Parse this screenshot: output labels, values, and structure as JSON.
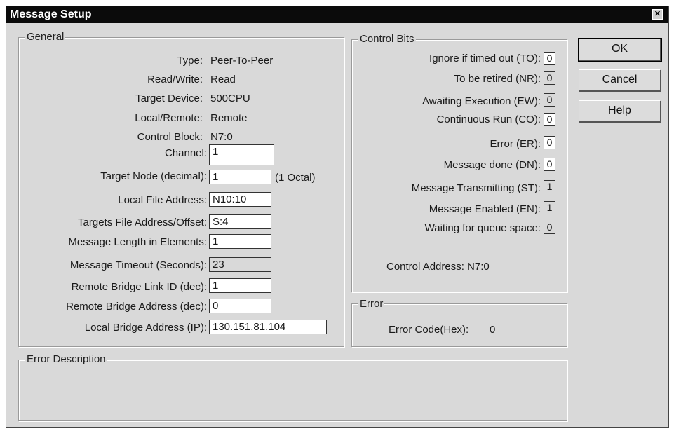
{
  "window": {
    "title": "Message Setup"
  },
  "general": {
    "legend": "General",
    "info": [
      {
        "label": "Type:",
        "value": "Peer-To-Peer"
      },
      {
        "label": "Read/Write:",
        "value": "Read"
      },
      {
        "label": "Target Device:",
        "value": "500CPU"
      },
      {
        "label": "Local/Remote:",
        "value": "Remote"
      },
      {
        "label": "Control Block:",
        "value": "N7:0"
      }
    ],
    "fields": [
      {
        "label": "Channel:",
        "value": "1"
      },
      {
        "label": "Target Node (decimal):",
        "value": "1",
        "suffix": "(1 Octal)"
      },
      {
        "label": "Local File Address:",
        "value": "N10:10"
      },
      {
        "label": "Targets File Address/Offset:",
        "value": "S:4"
      },
      {
        "label": "Message Length in Elements:",
        "value": "1"
      },
      {
        "label": "Message Timeout (Seconds):",
        "value": "23"
      },
      {
        "label": "Remote Bridge Link ID (dec):",
        "value": "1"
      },
      {
        "label": "Remote Bridge Address (dec):",
        "value": "0"
      },
      {
        "label": "Local Bridge Address (IP):",
        "value": "130.151.81.104"
      }
    ]
  },
  "control_bits": {
    "legend": "Control Bits",
    "bits": [
      {
        "label": "Ignore if timed out (TO):",
        "value": "0"
      },
      {
        "label": "To be retired (NR):",
        "value": "0"
      },
      {
        "label": "Awaiting Execution (EW):",
        "value": "0"
      },
      {
        "label": "Continuous Run (CO):",
        "value": "0"
      },
      {
        "label": "Error (ER):",
        "value": "0"
      },
      {
        "label": "Message done (DN):",
        "value": "0"
      },
      {
        "label": "Message Transmitting (ST):",
        "value": "1"
      },
      {
        "label": "Message Enabled (EN):",
        "value": "1"
      },
      {
        "label": "Waiting for queue space:",
        "value": "0"
      }
    ],
    "control_address": "Control Address: N7:0"
  },
  "error": {
    "legend": "Error",
    "code_label": "Error Code(Hex):",
    "code_value": "0"
  },
  "error_description": {
    "legend": "Error Description"
  },
  "buttons": {
    "ok": "OK",
    "cancel": "Cancel",
    "help": "Help"
  }
}
